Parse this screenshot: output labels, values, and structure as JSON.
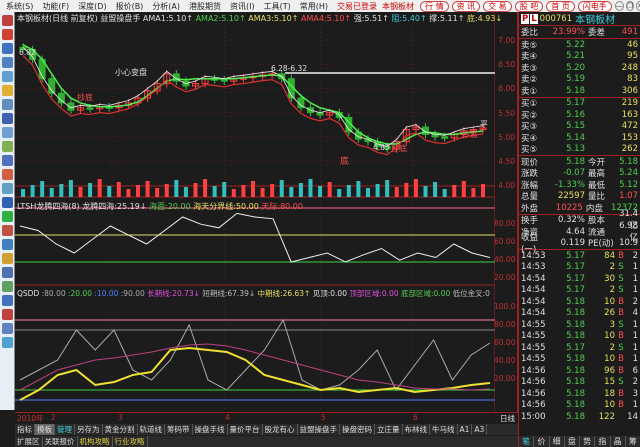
{
  "menu": {
    "items": [
      "系统(S)",
      "功能(F)",
      "深度(D)",
      "报价(B)",
      "分析(A)",
      "港股期货",
      "资讯(I)",
      "工具(T)",
      "常用(H)"
    ],
    "login_status": "交易已登录",
    "stock_name": "本钢板材",
    "buttons": [
      "行 情",
      "资 讯",
      "交 易",
      "股 吧",
      "首 页",
      "闪电手"
    ],
    "win": [
      "—",
      "❐",
      "✕"
    ]
  },
  "chart_header": {
    "title": "本钢板材(日线 前复权) 益盟操盘手",
    "ama1": "AMA1:5.10↑",
    "ama2": "AMA2:5.10↑",
    "ama3": "AMA3:5.10↑",
    "ama4": "AMA4:5.10↑",
    "qiang": "强:5.51↑",
    "zu": "阻:5.40↑",
    "cheng": "撑:5.11↑",
    "di": "底:4.93↓"
  },
  "annotations": {
    "high": "6.82",
    "mid": "6.28-6.32",
    "low": "4.85",
    "chaodi1": "抄底",
    "chaodi2": "抄底",
    "chaodi3": "抄底",
    "xiaoxin": "小心变盘",
    "di": "底",
    "ping": "平"
  },
  "ltsh": {
    "name": "LTSH龙腾四海(8)",
    "v1": "龙腾四海:25.19↓",
    "v2": "海面:20.00",
    "v3": "海天分界线:50.00",
    "v4": "天际:80.00"
  },
  "qsdd": {
    "name": "QSDD",
    "p1": ":80.00",
    "p2": ":20.00",
    "p3": ":10.00",
    "p4": ":90.00",
    "v1": "长期线:20.73↓",
    "v2": "短期线:67.39↓",
    "v3": "中期线:26.63↑",
    "v4": "见顶:0.00",
    "v5": "顶部区域:0.00",
    "v6": "底部区域:0.00",
    "v7": "低位金叉:0"
  },
  "axes": {
    "price": [
      "7.00",
      "6.50",
      "6.00",
      "5.50",
      "5.00",
      "4.50",
      "4.00"
    ],
    "ltsh": [
      "80.00",
      "60.00",
      "40.00",
      "20.00"
    ],
    "qsdd": [
      "100.0",
      "80.00",
      "60.00",
      "40.00",
      "20.00"
    ],
    "dates": [
      "2010年",
      "2",
      "3",
      "4",
      "5",
      "6"
    ],
    "period": "日线"
  },
  "bottom_tabs": [
    "指标",
    "模板",
    "管理",
    "另存为",
    "黄金分割",
    "轨道线",
    "筹码带",
    "操盘手线",
    "量价平台",
    "股龙有心",
    "益盟操盘手",
    "操盘密码",
    "立庄量",
    "布林线",
    "牛马线",
    "A1",
    "A3"
  ],
  "bottom_tabs2": [
    "扩展区",
    "关联报价",
    "机构攻略",
    "行业攻略"
  ],
  "quote": {
    "code": "000761",
    "name": "本钢板材",
    "weibi_label": "委比",
    "weibi": "23.99%",
    "weicha_label": "委差",
    "weicha": "491",
    "sells": [
      {
        "l": "卖⑤",
        "p": "5.22",
        "v": "46"
      },
      {
        "l": "卖④",
        "p": "5.21",
        "v": "95"
      },
      {
        "l": "卖③",
        "p": "5.20",
        "v": "248"
      },
      {
        "l": "卖②",
        "p": "5.19",
        "v": "83"
      },
      {
        "l": "卖①",
        "p": "5.18",
        "v": "306"
      }
    ],
    "buys": [
      {
        "l": "买①",
        "p": "5.17",
        "v": "219"
      },
      {
        "l": "买②",
        "p": "5.16",
        "v": "163"
      },
      {
        "l": "买③",
        "p": "5.15",
        "v": "472"
      },
      {
        "l": "买④",
        "p": "5.14",
        "v": "153"
      },
      {
        "l": "买⑤",
        "p": "5.13",
        "v": "262"
      }
    ],
    "stats": [
      [
        "现价",
        "5.18",
        "今开",
        "5.18"
      ],
      [
        "涨跌",
        "-0.07",
        "最高",
        "5.24"
      ],
      [
        "涨幅",
        "-1.33%",
        "最低",
        "5.12"
      ],
      [
        "总量",
        "22597",
        "量比",
        "1.07"
      ],
      [
        "外盘",
        "10225",
        "内盘",
        "12372"
      ]
    ],
    "stats2": [
      [
        "换手",
        "0.32%",
        "股本",
        "31.4亿"
      ],
      [
        "净资",
        "4.64",
        "流通",
        "6.98亿"
      ],
      [
        "收益(一)",
        "0.119",
        "PE(动)",
        "10.9"
      ]
    ],
    "ticks": [
      [
        "14:53",
        "5.17",
        "84",
        "B",
        "2"
      ],
      [
        "14:53",
        "5.17",
        "2",
        "S",
        "1"
      ],
      [
        "14:54",
        "5.17",
        "30",
        "S",
        "1"
      ],
      [
        "14:54",
        "5.17",
        "2",
        "S",
        "1"
      ],
      [
        "14:54",
        "5.18",
        "10",
        "B",
        "2"
      ],
      [
        "14:54",
        "5.18",
        "26",
        "B",
        "4"
      ],
      [
        "14:55",
        "5.18",
        "3",
        "S",
        "1"
      ],
      [
        "14:55",
        "5.18",
        "10",
        "B",
        "1"
      ],
      [
        "14:55",
        "5.17",
        "2",
        "S",
        "1"
      ],
      [
        "14:55",
        "5.18",
        "10",
        "B",
        "1"
      ],
      [
        "14:56",
        "5.18",
        "96",
        "B",
        "6"
      ],
      [
        "14:56",
        "5.18",
        "15",
        "S",
        "2"
      ],
      [
        "14:56",
        "5.18",
        "18",
        "B",
        "3"
      ],
      [
        "14:56",
        "5.18",
        "10",
        "B",
        "1"
      ],
      [
        "15:00",
        "5.18",
        "122",
        "",
        "14"
      ]
    ],
    "tabs": [
      "笔",
      "价",
      "细",
      "盘",
      "势",
      "指",
      "晶",
      "筹"
    ]
  },
  "chart_data": [
    {
      "type": "candlestick",
      "title": "本钢板材 日线",
      "ylim": [
        4.0,
        7.0
      ],
      "close": [
        6.8,
        6.6,
        6.2,
        5.9,
        5.7,
        5.55,
        5.6,
        5.58,
        5.62,
        5.6,
        5.65,
        5.7,
        5.8,
        5.95,
        6.1,
        6.3,
        6.15,
        6.05,
        6.1,
        6.2,
        6.18,
        6.15,
        6.2,
        6.22,
        6.25,
        6.28,
        6.3,
        6.2,
        5.8,
        5.6,
        5.5,
        5.45,
        5.5,
        5.4,
        5.1,
        4.95,
        4.9,
        4.8,
        4.75,
        4.9,
        5.15,
        5.2,
        5.05,
        5.0,
        4.98,
        5.05,
        5.12,
        5.15,
        5.18
      ],
      "ma_green": [
        6.9,
        6.8,
        6.6,
        6.3,
        6.0,
        5.8,
        5.7,
        5.65,
        5.62,
        5.62,
        5.63,
        5.66,
        5.72,
        5.85,
        6.0,
        6.15,
        6.2,
        6.18,
        6.2,
        6.2,
        6.2,
        6.2,
        6.2,
        6.22,
        6.24,
        6.26,
        6.28,
        6.25,
        6.05,
        5.85,
        5.7,
        5.6,
        5.55,
        5.5,
        5.3,
        5.1,
        4.98,
        4.9,
        4.85,
        4.85,
        4.95,
        5.05,
        5.1,
        5.08,
        5.05,
        5.05,
        5.08,
        5.1,
        5.12
      ]
    },
    {
      "type": "line",
      "title": "LTSH龙腾四海",
      "ylim": [
        0,
        100
      ],
      "values": [
        60,
        55,
        40,
        30,
        45,
        60,
        50,
        40,
        55,
        70,
        62,
        58,
        74,
        70,
        68,
        20,
        25,
        30,
        20,
        28,
        35,
        22,
        30,
        25,
        40,
        30,
        25
      ]
    },
    {
      "type": "line",
      "title": "QSDD",
      "ylim": [
        0,
        100
      ],
      "series": [
        {
          "name": "短期线",
          "values": [
            30,
            40,
            50,
            80,
            60,
            80,
            40,
            30,
            50,
            85,
            30,
            20,
            40,
            60,
            90,
            30,
            20,
            25,
            40,
            60,
            20,
            45,
            70,
            30,
            55,
            67
          ]
        },
        {
          "name": "中期线",
          "values": [
            10,
            20,
            35,
            40,
            25,
            28,
            35,
            38,
            60,
            62,
            60,
            58,
            50,
            35,
            30,
            25,
            20,
            22,
            18,
            20,
            22,
            18,
            20,
            22,
            25,
            27
          ]
        },
        {
          "name": "长期线",
          "values": [
            20,
            30,
            40,
            45,
            50,
            52,
            55,
            58,
            62,
            65,
            66,
            64,
            60,
            55,
            50,
            45,
            40,
            35,
            30,
            28,
            25,
            22,
            21,
            21,
            20,
            21
          ]
        }
      ]
    }
  ]
}
